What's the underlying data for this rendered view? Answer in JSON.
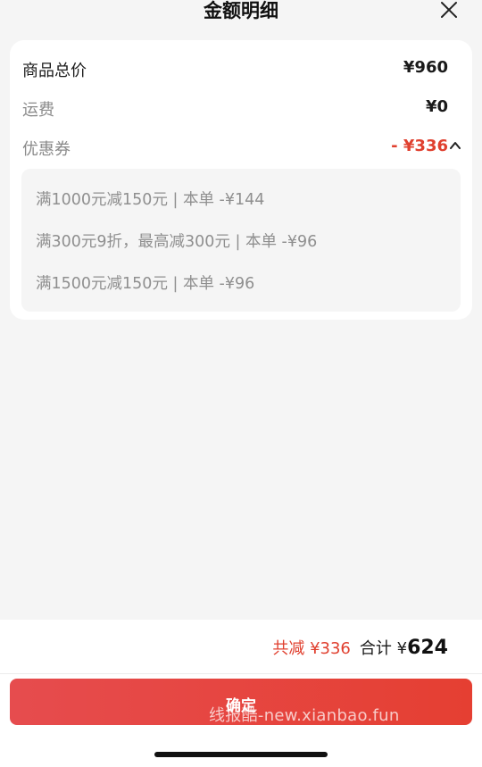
{
  "header": {
    "title": "金额明细"
  },
  "summary_card": {
    "rows": [
      {
        "label": "商品总价",
        "value": "¥960"
      },
      {
        "label": "运费",
        "value": "¥0"
      },
      {
        "label": "优惠券",
        "value": "- ¥336"
      }
    ],
    "coupons": [
      "满1000元减150元 | 本单 -¥144",
      "满300元9折，最高减300元 | 本单 -¥96",
      "满1500元减150元 | 本单 -¥96"
    ]
  },
  "footer": {
    "discount_text": "共减 ¥336",
    "total_label": "合计 ¥",
    "total_value": "624",
    "confirm_label": "确定",
    "watermark": "线报酷-new.xianbao.fun"
  },
  "colors": {
    "accent_red": "#e0402f",
    "button_gradient_start": "#e64c4e",
    "button_gradient_end": "#e53f32",
    "background": "#f5f5f5"
  },
  "icons": {
    "close": "close-icon",
    "collapse": "chevron-up-icon"
  }
}
